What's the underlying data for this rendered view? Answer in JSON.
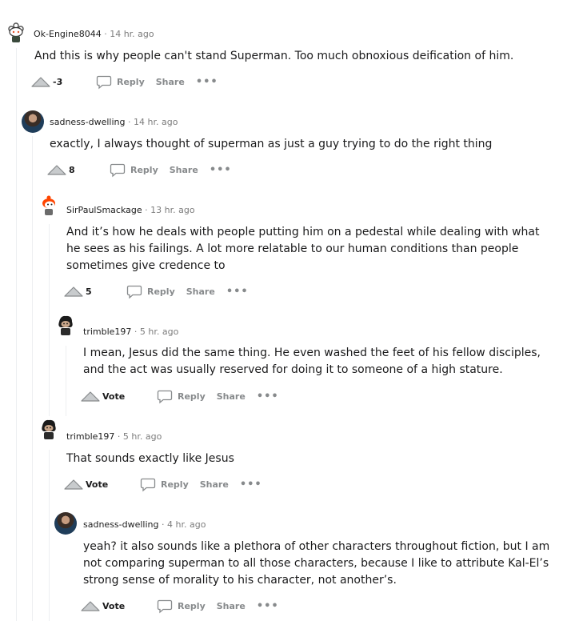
{
  "comments": [
    {
      "username": "Ok-Engine8044",
      "time": "14 hr. ago",
      "body": "And this is why people can't stand Superman. Too much obnoxious deification of him.",
      "score": "-3",
      "avatar": "snoo-avatar"
    },
    {
      "username": "sadness-dwelling",
      "time": "14 hr. ago",
      "body": "exactly, I always thought of superman as just a guy trying to do the right thing",
      "score": "8",
      "avatar": "photo-avatar"
    },
    {
      "username": "SirPaulSmackage",
      "time": "13 hr. ago",
      "body": "And it’s how he deals with people putting him on a pedestal while dealing with what he sees as his failings. A lot more relatable to our human conditions than people sometimes give credence to",
      "score": "5",
      "avatar": "snoo-avatar"
    },
    {
      "username": "trimble197",
      "time": "5 hr. ago",
      "body": "I mean, Jesus did the same thing. He even washed the feet of his fellow disciples, and the act was usually reserved for doing it to someone of a high stature.",
      "score": "Vote",
      "avatar": "snoo-avatar"
    },
    {
      "username": "trimble197",
      "time": "5 hr. ago",
      "body": "That sounds exactly like Jesus",
      "score": "Vote",
      "avatar": "snoo-avatar"
    },
    {
      "username": "sadness-dwelling",
      "time": "4 hr. ago",
      "body": "yeah? it also sounds like a plethora of other characters throughout fiction, but I am not comparing superman to all those characters, because I like to attribute Kal-El’s strong sense of morality to his character, not another’s.",
      "score": "Vote",
      "avatar": "photo-avatar"
    }
  ],
  "labels": {
    "separator": "·",
    "reply": "Reply",
    "share": "Share",
    "more": "•••"
  },
  "colors": {
    "text": "#1a1a1b",
    "meta": "#7c7c7c",
    "action": "#878a8c",
    "thread_line": "#edeff1"
  }
}
